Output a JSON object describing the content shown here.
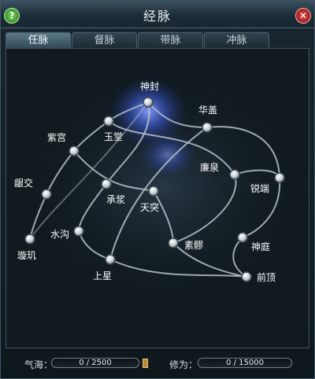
{
  "window": {
    "title": "经脉"
  },
  "buttons": {
    "help": "?",
    "close": "✕"
  },
  "tabs": [
    {
      "label": "任脉",
      "active": true
    },
    {
      "label": "督脉",
      "active": false
    },
    {
      "label": "带脉",
      "active": false
    },
    {
      "label": "冲脉",
      "active": false
    }
  ],
  "nodes": [
    {
      "id": "shenfeng",
      "label": "神封"
    },
    {
      "id": "yutang",
      "label": "玉堂"
    },
    {
      "id": "huagai",
      "label": "华盖"
    },
    {
      "id": "zigong",
      "label": "紫宫"
    },
    {
      "id": "kanquan",
      "label": "廉泉"
    },
    {
      "id": "ruiduan",
      "label": "锐端"
    },
    {
      "id": "yinjiao",
      "label": "龈交"
    },
    {
      "id": "chengjiang",
      "label": "承浆"
    },
    {
      "id": "tiantu",
      "label": "天突"
    },
    {
      "id": "shuigou",
      "label": "水沟"
    },
    {
      "id": "xuanji",
      "label": "璇玑"
    },
    {
      "id": "suliao",
      "label": "素髎"
    },
    {
      "id": "shenting",
      "label": "神庭"
    },
    {
      "id": "shangxing",
      "label": "上星"
    },
    {
      "id": "qianding",
      "label": "前顶"
    }
  ],
  "stats": {
    "qihai": {
      "label": "气海：",
      "value": "0 / 2500"
    },
    "xiuwei": {
      "label": "修为：",
      "value": "0 / 15000"
    }
  },
  "colors": {
    "glow": "#5a78ff",
    "line": "#b8c2ca",
    "node": "#d9dde0"
  }
}
